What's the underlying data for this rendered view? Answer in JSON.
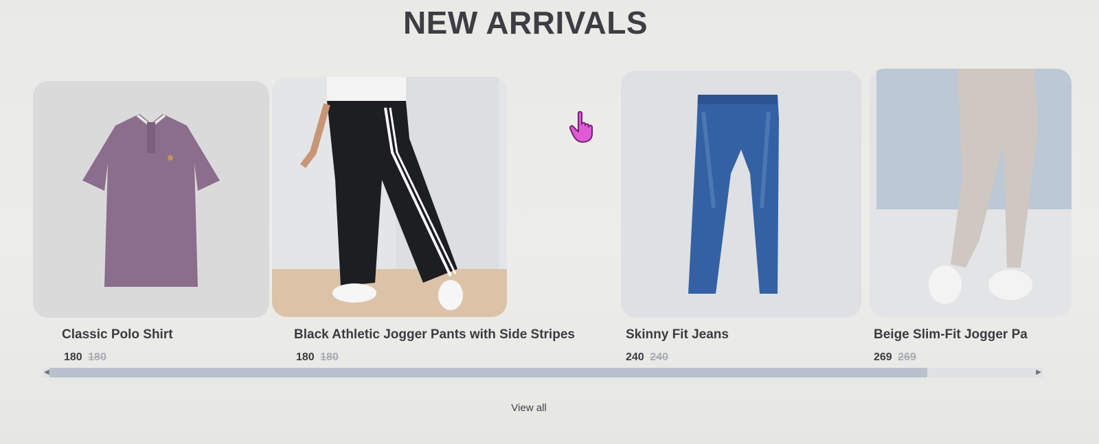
{
  "section": {
    "title": "NEW ARRIVALS",
    "view_all_label": "View all"
  },
  "products": [
    {
      "name": "Classic Polo Shirt",
      "price": "180",
      "original_price": "180",
      "image_icon": "polo-shirt-icon"
    },
    {
      "name": "Black Athletic Jogger Pants with Side Stripes",
      "price": "180",
      "original_price": "180",
      "image_icon": "jogger-pants-icon"
    },
    {
      "name": "Skinny Fit Jeans",
      "price": "240",
      "original_price": "240",
      "image_icon": "jeans-icon"
    },
    {
      "name": "Beige Slim-Fit Jogger Pa",
      "price": "269",
      "original_price": "269",
      "image_icon": "beige-jogger-icon"
    }
  ],
  "scrollbar": {
    "position_fraction": 0.0,
    "visible_fraction": 0.89
  },
  "colors": {
    "background": "#ebebe8",
    "title": "#3c3e44",
    "strikethrough": "#a7acb6",
    "scroll_thumb": "#b9c1cd",
    "cursor": "#e05ad8"
  }
}
